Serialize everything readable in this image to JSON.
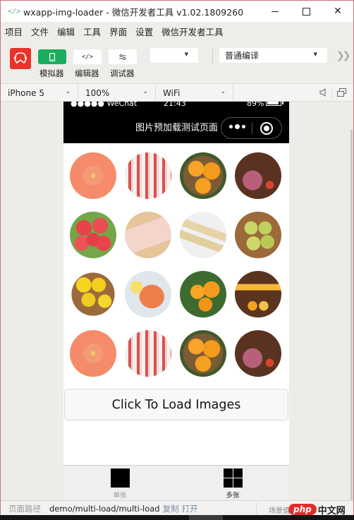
{
  "window": {
    "title": "wxapp-img-loader - 微信开发者工具 v1.02.1809260",
    "app_icon": "code-brackets-icon",
    "controls": [
      "minimize",
      "maximize",
      "close"
    ]
  },
  "menubar": {
    "items": [
      "项目",
      "文件",
      "编辑",
      "工具",
      "界面",
      "设置",
      "微信开发者工具"
    ]
  },
  "toolbar": {
    "avatar_icon": "user-avatar-icon",
    "buttons": [
      {
        "label": "模拟器",
        "icon": "phone-icon",
        "active": true
      },
      {
        "label": "编辑器",
        "icon": "code-icon",
        "active": false
      },
      {
        "label": "调试器",
        "icon": "debug-settings-icon",
        "active": false
      }
    ],
    "mode_select": {
      "value": ""
    },
    "compile_select": {
      "value": "普通编译"
    },
    "more_icon": "double-chevron-right-icon"
  },
  "devicebar": {
    "device": "iPhone 5",
    "zoom": "100%",
    "network": "WiFi",
    "right_icons": [
      "speaker-icon",
      "detach-window-icon"
    ]
  },
  "phone": {
    "statusbar": {
      "signal": "●●●●● WeChat",
      "time": "21:43",
      "battery": "89%",
      "battery_level": 0.89
    },
    "nav": {
      "title": "图片预加载测试页面",
      "capsule_more_icon": "more-dots-icon",
      "capsule_home_icon": "record-circle-icon"
    },
    "grid": {
      "rows": [
        [
          "salmon",
          "pork-belly-slices",
          "oranges-basket",
          "lamb-leg"
        ],
        [
          "apples",
          "pork-on-board",
          "fish",
          "pears"
        ],
        [
          "lemons",
          "shrimp",
          "oranges-leaves",
          "juice-175"
        ],
        [
          "salmon",
          "pork-belly-slices",
          "oranges-basket",
          "lamb-leg"
        ]
      ]
    },
    "load_button": "Click To Load Images",
    "tabbar": {
      "tabs": [
        {
          "label": "单张",
          "icon": "single-square-icon",
          "active": false
        },
        {
          "label": "多张",
          "icon": "grid-four-icon",
          "active": true
        }
      ]
    }
  },
  "pathbar": {
    "label": "页面路径",
    "path": "demo/multi-load/multi-load",
    "copy": "复制",
    "open": "打开",
    "scene_label": "场景值"
  },
  "watermark": {
    "brand": "php",
    "text": "中文网"
  }
}
